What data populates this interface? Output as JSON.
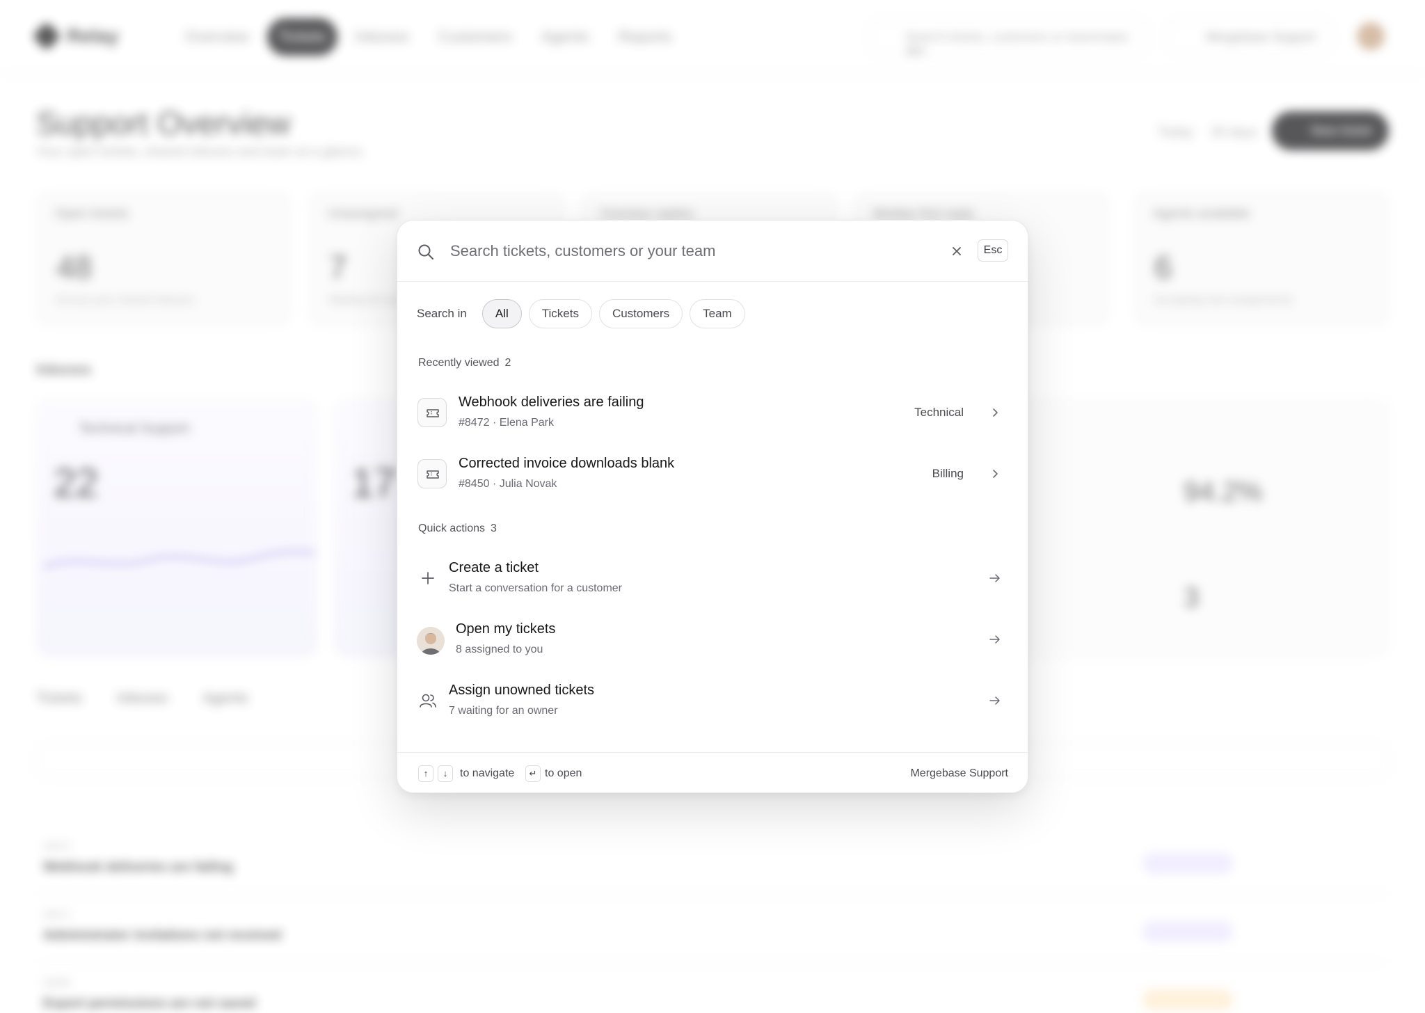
{
  "background": {
    "app_name": "Relay",
    "nav": [
      "Overview",
      "Tickets",
      "Inboxes",
      "Customers",
      "Agents",
      "Reports"
    ],
    "global_search_placeholder": "Search tickets, customers or teammates  ⌘K",
    "workspace": "Mergebase Support",
    "page_title": "Support Overview",
    "page_subtitle": "Your open tickets, shared inboxes and team at a glance.",
    "range_today": "Today",
    "range_30": "30 days",
    "new_ticket": "New ticket",
    "kpis": [
      {
        "label": "Open tickets",
        "value": "48",
        "sub": "Across your shared inboxes"
      },
      {
        "label": "Unassigned",
        "value": "7",
        "sub": "Waiting for an owner"
      },
      {
        "label": "Overdue replies",
        "value": "",
        "sub": ""
      },
      {
        "label": "Median first reply",
        "value": "",
        "sub": ""
      },
      {
        "label": "Agents available",
        "value": "6",
        "sub": "Accepting new assignments"
      }
    ],
    "inboxes_title": "Inboxes",
    "inbox_cards": [
      {
        "name": "Technical Support",
        "count": "22"
      },
      {
        "name": "",
        "count": "17"
      }
    ],
    "right_panel": {
      "metric1": "94.2%",
      "metric2": "3"
    },
    "table_tabs": [
      "Tickets",
      "Inboxes",
      "Agents"
    ],
    "rows": [
      {
        "id": "#8472",
        "title": "Webhook deliveries are failing"
      },
      {
        "id": "#8471",
        "title": "Administrator invitations not received"
      },
      {
        "id": "#8469",
        "title": "Export permissions are not saved"
      }
    ]
  },
  "modal": {
    "search_placeholder": "Search tickets, customers or your team",
    "esc_label": "Esc",
    "scope_label": "Search in",
    "scopes": [
      {
        "label": "All",
        "active": true
      },
      {
        "label": "Tickets",
        "active": false
      },
      {
        "label": "Customers",
        "active": false
      },
      {
        "label": "Team",
        "active": false
      }
    ],
    "recent": {
      "title": "Recently viewed",
      "count": "2",
      "items": [
        {
          "title": "Webhook deliveries are failing",
          "meta": "#8472 · Elena Park",
          "tag": "Technical",
          "icon": "ticket-icon"
        },
        {
          "title": "Corrected invoice downloads blank",
          "meta": "#8450 · Julia Novak",
          "tag": "Billing",
          "icon": "ticket-icon"
        }
      ]
    },
    "actions": {
      "title": "Quick actions",
      "count": "3",
      "items": [
        {
          "title": "Create a ticket",
          "meta": "Start a conversation for a customer",
          "icon": "plus-icon"
        },
        {
          "title": "Open my tickets",
          "meta": "8 assigned to you",
          "icon": "avatar"
        },
        {
          "title": "Assign unowned tickets",
          "meta": "7 waiting for an owner",
          "icon": "users-icon"
        }
      ]
    },
    "footer": {
      "navigate": "to navigate",
      "open": "to open",
      "workspace": "Mergebase Support"
    }
  }
}
